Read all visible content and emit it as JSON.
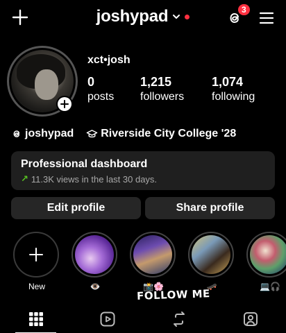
{
  "header": {
    "username": "joshypad",
    "notification_count": "3",
    "icons": [
      "plus-icon",
      "chevron-down-icon",
      "threads-icon",
      "menu-icon"
    ],
    "accent_color": "#ff3040"
  },
  "profile": {
    "display_name": "xct•josh",
    "stats": [
      {
        "value": "0",
        "label": "posts"
      },
      {
        "value": "1,215",
        "label": "followers"
      },
      {
        "value": "1,074",
        "label": "following"
      }
    ],
    "threads_handle": "joshypad",
    "school": "Riverside City College '28"
  },
  "dashboard": {
    "title": "Professional dashboard",
    "subtitle": "11.3K views in the last 30 days.",
    "trend_color": "#58c322"
  },
  "actions": {
    "edit_label": "Edit profile",
    "share_label": "Share profile"
  },
  "highlights": {
    "new_label": "New",
    "items": [
      {
        "label": "👁️"
      },
      {
        "label": "📸🌸"
      },
      {
        "label": "🛹"
      },
      {
        "label": "💻🎧"
      }
    ]
  },
  "sticker": {
    "text": "FOLLOW ME"
  },
  "tabs": [
    "grid-icon",
    "reels-icon",
    "reposts-icon",
    "tagged-icon"
  ]
}
